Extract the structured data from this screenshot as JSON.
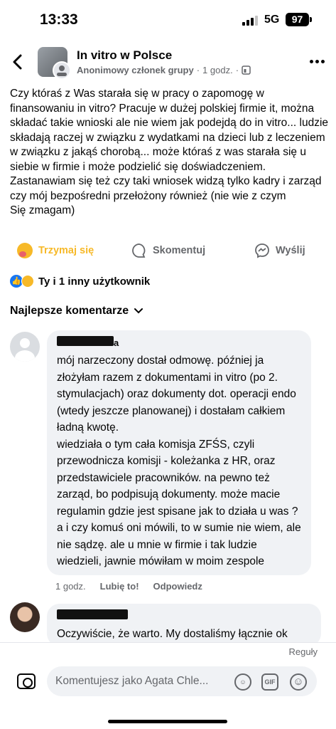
{
  "status_bar": {
    "time": "13:33",
    "network": "5G",
    "battery": "97"
  },
  "post": {
    "group_name": "In vitro w Polsce",
    "author": "Anonimowy członek grupy",
    "separator": "·",
    "time": "1 godz.",
    "text": "Czy któraś z Was starała się w pracy o zapomogę w finansowaniu in vitro? Pracuje w dużej polskiej firmie it, można składać takie wnioski ale nie wiem jak podejdą do in vitro... ludzie składają raczej w związku z wydatkami na dzieci lub z leczeniem w związku z jakąś chorobą... może któraś z was starała się u siebie w firmie i może podzielić się doświadczeniem. Zastanawiam się też czy taki wniosek widzą tylko kadry i zarząd czy mój bezpośredni przełożony również (nie wie z czym\nSię zmagam)"
  },
  "actions": {
    "react": "Trzymaj się",
    "comment": "Skomentuj",
    "share": "Wyślij"
  },
  "reactions_summary": {
    "text": "Ty i 1 inny użytkownik"
  },
  "comments_sort": {
    "label": "Najlepsze komentarze"
  },
  "comments": [
    {
      "author_suffix": "a",
      "text": "mój narzeczony dostał odmowę. później ja złożyłam razem z dokumentami in vitro (po 2. stymulacjach) oraz dokumenty dot. operacji endo (wtedy jeszcze planowanej) i dostałam całkiem ładną kwotę.\nwiedziała o tym cała komisja ZFŚS, czyli przewodnicza komisji - koleżanka z HR, oraz przedstawiciele pracowników. na pewno też zarząd, bo podpisują dokumenty. może macie regulamin gdzie jest spisane jak to działa u was ?\na i czy komuś oni mówili, to w sumie nie wiem, ale nie sądzę. ale u mnie w firmie i tak ludzie wiedzieli, jawnie mówiłam w moim zespole",
      "time": "1 godz.",
      "like_label": "Lubię to!",
      "reply_label": "Odpowiedz"
    },
    {
      "text": "Oczywiście, że warto. My dostaliśmy łącznie ok"
    }
  ],
  "composer": {
    "rules_label": "Reguły",
    "placeholder": "Komentujesz jako Agata Chle...",
    "gif_label": "GIF"
  },
  "colors": {
    "accent": "#1877f2",
    "hug": "#f7b928",
    "muted": "#65676b",
    "bubble": "#f0f2f5"
  }
}
